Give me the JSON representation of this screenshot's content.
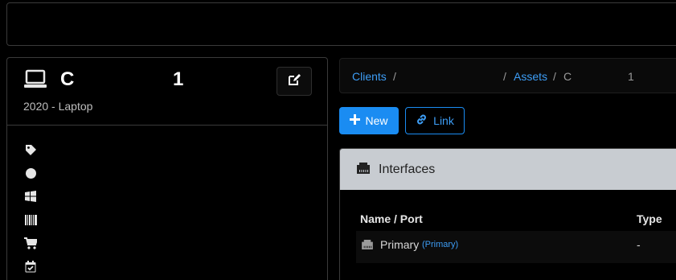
{
  "asset": {
    "name": "C",
    "number": "1",
    "subtitle": "2020 - Laptop",
    "icons": [
      "tag-icon",
      "circle-icon",
      "windows-icon",
      "barcode-icon",
      "cart-icon",
      "calendar-check-icon"
    ]
  },
  "breadcrumb": {
    "clients": "Clients",
    "sep1": "/",
    "sep2": "/",
    "assets": "Assets",
    "sep3": "/",
    "current": "C",
    "current_num": "1"
  },
  "actions": {
    "new_label": "New",
    "link_label": "Link"
  },
  "interfaces": {
    "title": "Interfaces",
    "columns": [
      "Name / Port",
      "Type"
    ],
    "rows": [
      {
        "name": "Primary",
        "tag": "(Primary)",
        "type": "-"
      }
    ]
  },
  "colors": {
    "accent": "#1a8cf2",
    "link": "#3d9df5",
    "panel_header": "#c8ccd1"
  }
}
